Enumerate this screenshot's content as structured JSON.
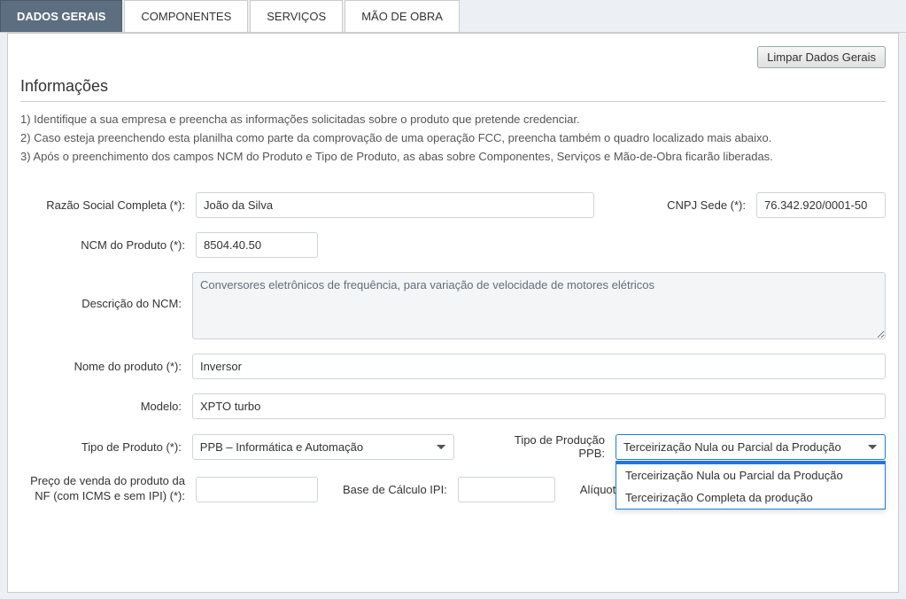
{
  "tabs": {
    "dados_gerais": "DADOS GERAIS",
    "componentes": "COMPONENTES",
    "servicos": "SERVIÇOS",
    "mao_de_obra": "MÃO DE OBRA"
  },
  "actions": {
    "limpar": "Limpar Dados Gerais"
  },
  "info": {
    "title": "Informações",
    "line1": "1) Identifique a sua empresa e preencha as informações solicitadas sobre o produto que pretende credenciar.",
    "line2": "2) Caso esteja preenchendo esta planilha como parte da comprovação de uma operação FCC, preencha também o quadro localizado mais abaixo.",
    "line3": "3) Após o preenchimento dos campos NCM do Produto e Tipo de Produto, as abas sobre Componentes, Serviços e Mão-de-Obra ficarão liberadas."
  },
  "form": {
    "razao_social": {
      "label": "Razão Social Completa (*):",
      "value": "João da Silva"
    },
    "cnpj": {
      "label": "CNPJ Sede (*):",
      "value": "76.342.920/0001-50"
    },
    "ncm": {
      "label": "NCM do Produto (*):",
      "value": "8504.40.50"
    },
    "desc_ncm": {
      "label": "Descrição do NCM:",
      "value": "Conversores eletrônicos de frequência, para variação de velocidade de motores elétricos"
    },
    "nome_produto": {
      "label": "Nome do produto (*):",
      "value": "Inversor"
    },
    "modelo": {
      "label": "Modelo:",
      "value": "XPTO turbo"
    },
    "tipo_produto": {
      "label": "Tipo de Produto (*):",
      "value": "PPB – Informática e Automação"
    },
    "tipo_producao": {
      "label": "Tipo de Produção PPB:",
      "value": "Terceirização Nula ou Parcial da Produção",
      "options": [
        "Terceirização Nula ou Parcial da Produção",
        "Terceirização Completa da produção"
      ]
    },
    "preco_venda": {
      "label": "Preço de venda do produto da NF (com ICMS e sem IPI) (*):",
      "value": ""
    },
    "base_ipi": {
      "label": "Base de Cálculo IPI:",
      "value": ""
    },
    "aliquota": {
      "label": "Alíquota do I",
      "value": ""
    }
  }
}
